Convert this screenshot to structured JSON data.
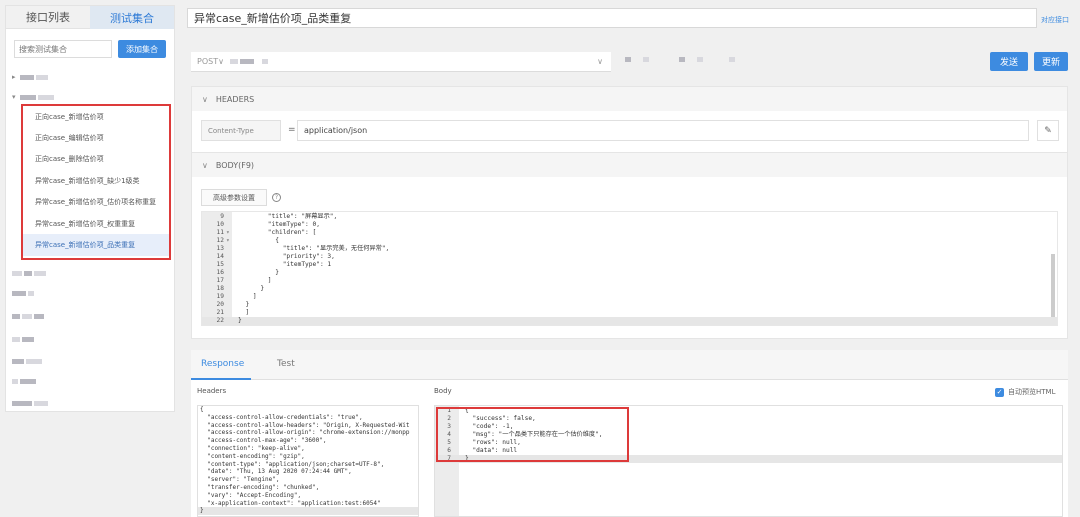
{
  "sidebar": {
    "tabs": [
      "接口列表",
      "测试集合"
    ],
    "search_placeholder": "搜索测试集合",
    "add_button": "添加集合",
    "cases": [
      "正向case_新增估价项",
      "正向case_编辑估价项",
      "正向case_删除估价项",
      "异常case_新增估价项_缺少1级类",
      "异常case_新增估价项_估价项名称重复",
      "异常case_新增估价项_权重重复",
      "异常case_新增估价项_品类重复"
    ],
    "active_case_index": 6
  },
  "header": {
    "title_value": "异常case_新增估价项_品类重复",
    "goto_link": "对应接口",
    "method": "POST",
    "send_button": "发送",
    "update_button": "更新"
  },
  "headers_section": {
    "label": "HEADERS",
    "key_placeholder": "Content-Type",
    "equals": "=",
    "value": "application/json"
  },
  "body_section": {
    "label": "BODY(F9)",
    "advanced_button": "高级参数设置",
    "help_icon": "?",
    "lines": [
      {
        "n": "9",
        "fold": false,
        "text": "        \"title\": \"屏幕显示\","
      },
      {
        "n": "10",
        "fold": false,
        "text": "        \"itemType\": 0,"
      },
      {
        "n": "11",
        "fold": true,
        "text": "        \"children\": ["
      },
      {
        "n": "12",
        "fold": true,
        "text": "          {"
      },
      {
        "n": "13",
        "fold": false,
        "text": "            \"title\": \"显示完美，无任何异常\","
      },
      {
        "n": "14",
        "fold": false,
        "text": "            \"priority\": 3,"
      },
      {
        "n": "15",
        "fold": false,
        "text": "            \"itemType\": 1"
      },
      {
        "n": "16",
        "fold": false,
        "text": "          }"
      },
      {
        "n": "17",
        "fold": false,
        "text": "        ]"
      },
      {
        "n": "18",
        "fold": false,
        "text": "      }"
      },
      {
        "n": "19",
        "fold": false,
        "text": "    ]"
      },
      {
        "n": "20",
        "fold": false,
        "text": "  }"
      },
      {
        "n": "21",
        "fold": false,
        "text": "  ]"
      },
      {
        "n": "22",
        "fold": false,
        "text": "}"
      }
    ]
  },
  "response": {
    "tabs": [
      "Response",
      "Test"
    ],
    "headers_label": "Headers",
    "body_label": "Body",
    "preview_label": "自动预览HTML",
    "headers_lines": [
      "{",
      "  \"access-control-allow-credentials\": \"true\",",
      "  \"access-control-allow-headers\": \"Origin, X-Requested-Wit",
      "  \"access-control-allow-origin\": \"chrome-extension://monpp",
      "  \"access-control-max-age\": \"3600\",",
      "  \"connection\": \"keep-alive\",",
      "  \"content-encoding\": \"gzip\",",
      "  \"content-type\": \"application/json;charset=UTF-8\",",
      "  \"date\": \"Thu, 13 Aug 2020 07:24:44 GMT\",",
      "  \"server\": \"Tengine\",",
      "  \"transfer-encoding\": \"chunked\",",
      "  \"vary\": \"Accept-Encoding\",",
      "  \"x-application-context\": \"application:test:6054\"",
      "}"
    ],
    "body_lines": [
      {
        "n": "1",
        "text": "{"
      },
      {
        "n": "2",
        "text": "  \"success\": false,"
      },
      {
        "n": "3",
        "text": "  \"code\": -1,"
      },
      {
        "n": "4",
        "text": "  \"msg\": \"一个品类下只能存在一个估价维度\","
      },
      {
        "n": "5",
        "text": "  \"rows\": null,"
      },
      {
        "n": "6",
        "text": "  \"data\": null"
      },
      {
        "n": "7",
        "text": "}"
      }
    ]
  },
  "colors": {
    "accent": "#3d8be0",
    "highlight_box": "#dd3a3a"
  }
}
